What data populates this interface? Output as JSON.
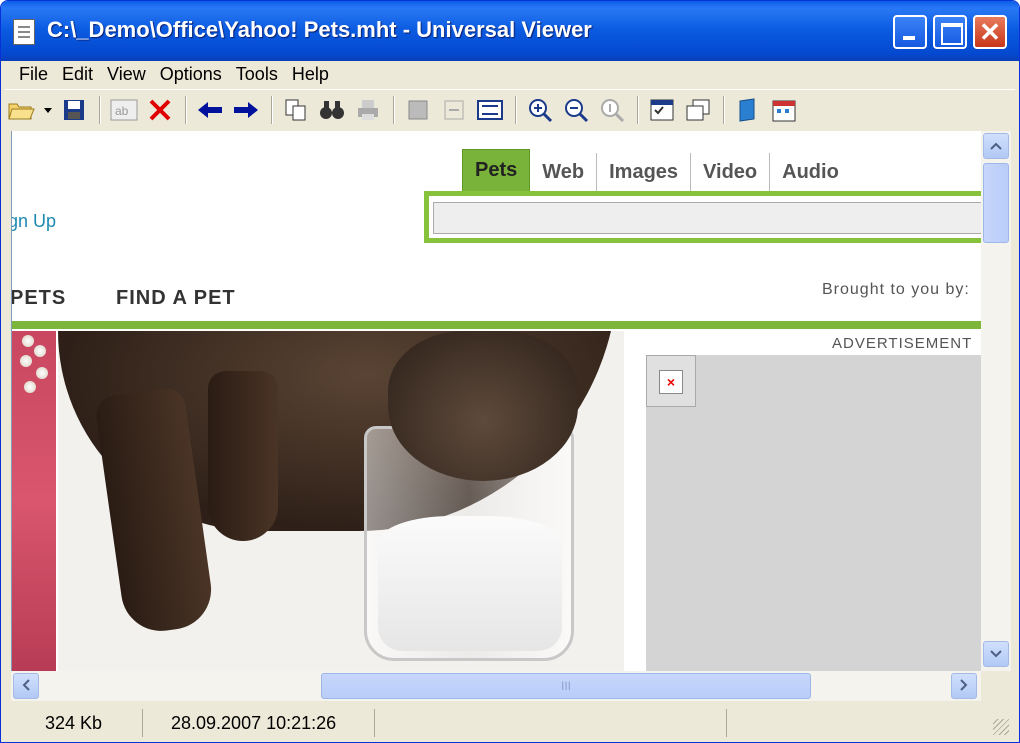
{
  "window": {
    "title": "C:\\_Demo\\Office\\Yahoo! Pets.mht - Universal Viewer",
    "close_glyph": "✕"
  },
  "menu": {
    "items": [
      {
        "label": "File"
      },
      {
        "label": "Edit"
      },
      {
        "label": "View"
      },
      {
        "label": "Options"
      },
      {
        "label": "Tools"
      },
      {
        "label": "Help"
      }
    ]
  },
  "toolbar": {
    "icons": [
      "open-folder-icon",
      "save-icon",
      "text-mode-icon",
      "close-file-icon",
      "back-arrow-icon",
      "forward-arrow-icon",
      "copy-icon",
      "find-icon",
      "print-icon",
      "fit-icon",
      "fit-width-icon",
      "fit-height-icon",
      "zoom-in-icon",
      "zoom-out-icon",
      "zoom-original-icon",
      "options-icon",
      "windows-icon",
      "book-icon",
      "calendar-icon"
    ]
  },
  "page": {
    "tabs": [
      {
        "label": "Pets",
        "active": true
      },
      {
        "label": "Web",
        "active": false
      },
      {
        "label": "Images",
        "active": false
      },
      {
        "label": "Video",
        "active": false
      },
      {
        "label": "Audio",
        "active": false
      }
    ],
    "signup_text": "gn Up",
    "nav": {
      "pets": "PETS",
      "find_a_pet": "FIND A PET"
    },
    "brought_to_you_by": "Brought to you by:",
    "ad_label": "ADVERTISEMENT",
    "broken_image_glyph": "×",
    "accent_color": "#7cb73c"
  },
  "scrollbars": {
    "thumb_glyph": "III"
  },
  "status": {
    "size": "324 Kb",
    "date": "28.09.2007 10:21:26"
  }
}
